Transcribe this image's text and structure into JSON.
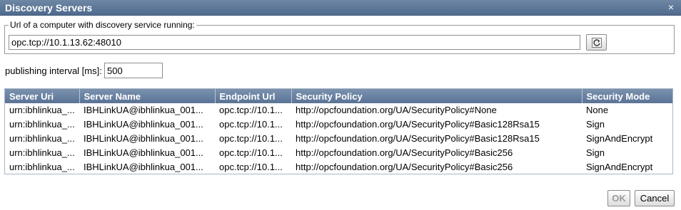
{
  "dialog": {
    "title": "Discovery Servers",
    "close_icon": "×"
  },
  "discovery": {
    "legend": "Url of a computer with discovery service running:",
    "url_value": "opc.tcp://10.1.13.62:48010",
    "refresh_icon": "refresh-icon"
  },
  "publishing": {
    "label": "publishing interval [ms]:",
    "value": "500"
  },
  "table": {
    "headers": [
      "Server Uri",
      "Server Name",
      "Endpoint Url",
      "Security Policy",
      "Security Mode"
    ],
    "rows": [
      [
        "urn:ibhlinkua_...",
        "IBHLinkUA@ibhlinkua_001...",
        "opc.tcp://10.1...",
        "http://opcfoundation.org/UA/SecurityPolicy#None",
        "None"
      ],
      [
        "urn:ibhlinkua_...",
        "IBHLinkUA@ibhlinkua_001...",
        "opc.tcp://10.1...",
        "http://opcfoundation.org/UA/SecurityPolicy#Basic128Rsa15",
        "Sign"
      ],
      [
        "urn:ibhlinkua_...",
        "IBHLinkUA@ibhlinkua_001...",
        "opc.tcp://10.1...",
        "http://opcfoundation.org/UA/SecurityPolicy#Basic128Rsa15",
        "SignAndEncrypt"
      ],
      [
        "urn:ibhlinkua_...",
        "IBHLinkUA@ibhlinkua_001...",
        "opc.tcp://10.1...",
        "http://opcfoundation.org/UA/SecurityPolicy#Basic256",
        "Sign"
      ],
      [
        "urn:ibhlinkua_...",
        "IBHLinkUA@ibhlinkua_001...",
        "opc.tcp://10.1...",
        "http://opcfoundation.org/UA/SecurityPolicy#Basic256",
        "SignAndEncrypt"
      ]
    ]
  },
  "buttons": {
    "ok": "OK",
    "cancel": "Cancel"
  },
  "colors": {
    "titlebar": "#5a7396",
    "header": "#6a83a3",
    "disabled_text": "#9a9a9a"
  }
}
